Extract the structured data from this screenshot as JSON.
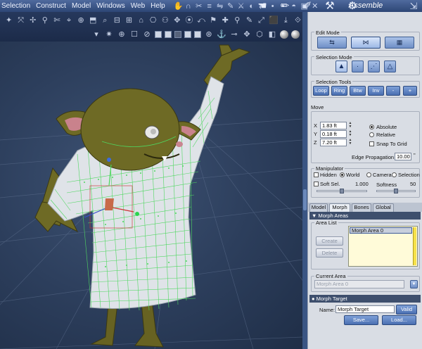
{
  "menubar": {
    "items": [
      "Selection",
      "Construct",
      "Model",
      "Windows",
      "Web",
      "Help"
    ],
    "tool_icons": [
      "hand-icon",
      "chisel-icon",
      "grab-icon",
      "scissors-icon",
      "align-icon",
      "mirror-icon",
      "brush-icon",
      "knife-icon",
      "paint-icon",
      "flip-icon",
      "dot-icon",
      "dot-icon",
      "bucket-icon",
      "stamp-icon",
      "axis-icon",
      "spray-icon"
    ],
    "room_tabs": [
      "hand-room-icon",
      "pencil-room-icon",
      "brush-room-icon",
      "bone-room-icon",
      "wrench-room-icon"
    ],
    "room_name": "Assemble"
  },
  "toolbar": {
    "row1_glyphs": [
      "✦",
      "⤧",
      "✢",
      "⚲",
      "✄",
      "⌖",
      "⊕",
      "⬒",
      "⌕",
      "⊟",
      "⊞",
      "⌂",
      "⎔",
      "⚇",
      "✥",
      "⦿",
      "⤺",
      "⚑",
      "✚",
      "⚲",
      "✎",
      "⤢",
      "⬛",
      "⤓",
      "⟐"
    ],
    "row2_glyphs": [
      "⊞",
      "⊠",
      "▢",
      "▣",
      "▤",
      "▥",
      "⊕",
      "⚙",
      "⊘",
      "✥",
      "⬡"
    ]
  },
  "panel": {
    "edit_mode": {
      "title": "Edit Mode"
    },
    "selection_mode": {
      "title": "Selection Mode",
      "buttons": [
        "▲",
        "·",
        "⋰",
        "△"
      ]
    },
    "selection_tools": {
      "title": "Selection Tools",
      "buttons": [
        "Loop",
        "Ring",
        "Btw",
        "Inv",
        "-",
        "+"
      ]
    },
    "move": {
      "title": "Move",
      "x_label": "X",
      "x_value": "1.83 ft",
      "y_label": "Y",
      "y_value": "0.18 ft",
      "z_label": "Z",
      "z_value": "7.20 ft",
      "absolute": "Absolute",
      "relative": "Relative",
      "snap": "Snap To Grid",
      "edge_label": "Edge Propagation",
      "edge_value": "10.00",
      "edge_unit": "\""
    },
    "manipulator": {
      "title": "Manipulator",
      "hidden": "Hidden",
      "world": "World",
      "camera": "Camera",
      "selection": "Selection",
      "soft_sel": "Soft Sel.",
      "soft_value": "1.000",
      "softness": "Softness",
      "softness_value": "50",
      "soft_sel_level": 0.5,
      "softness_level": 0.5
    },
    "tabs": [
      "Model",
      "Morph",
      "Bones",
      "Global"
    ],
    "active_tab": "Morph",
    "morph_areas": {
      "header": "▼ Morph Areas",
      "area_list_title": "Area List",
      "create": "Create",
      "delete": "Delete",
      "items": [
        "Morph Area 0"
      ]
    },
    "current_area": {
      "title": "Current Area",
      "value": "Morph Area 0"
    },
    "morph_target": {
      "header": "● Morph Target",
      "name_label": "Name:",
      "name_value": "Morph Target",
      "valid": "Valid",
      "save": "Save...",
      "load": "Load..."
    }
  },
  "colors": {
    "menubar": "#3f5a8c",
    "viewport_bg": "#2f4261",
    "panel_bg": "#d9dde4",
    "mesh_wire": "#57e06a",
    "character": "#6a6a22",
    "button_blue": "#5b7fc0"
  }
}
